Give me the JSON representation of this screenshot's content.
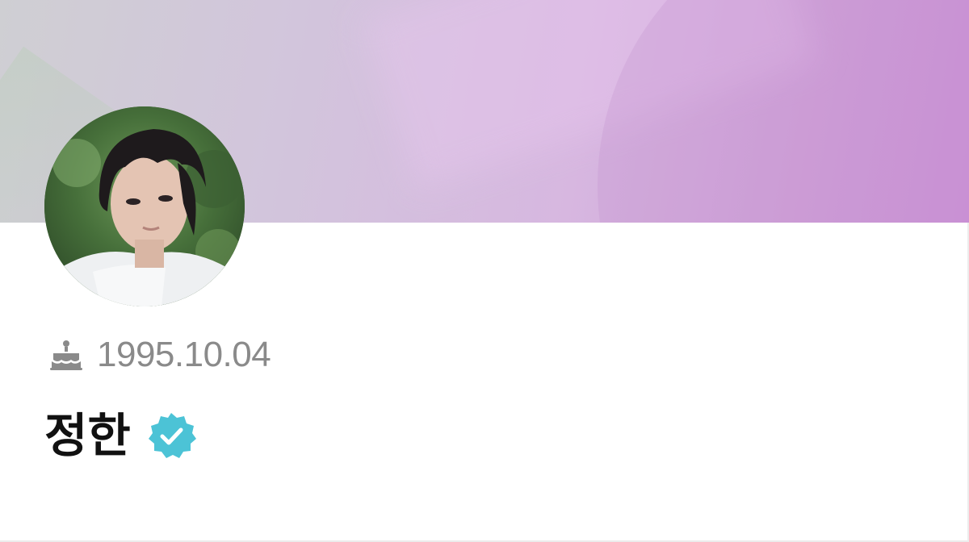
{
  "profile": {
    "birthday": "1995.10.04",
    "name": "정한",
    "verified": true,
    "cake_icon": "cake-icon",
    "verified_icon": "verified-badge-icon"
  },
  "colors": {
    "cover_start": "#cfcfd3",
    "cover_end": "#cc92d7",
    "verified_badge": "#4cc3d6",
    "birthday_text": "#8a8a8a",
    "name_text": "#111111"
  }
}
